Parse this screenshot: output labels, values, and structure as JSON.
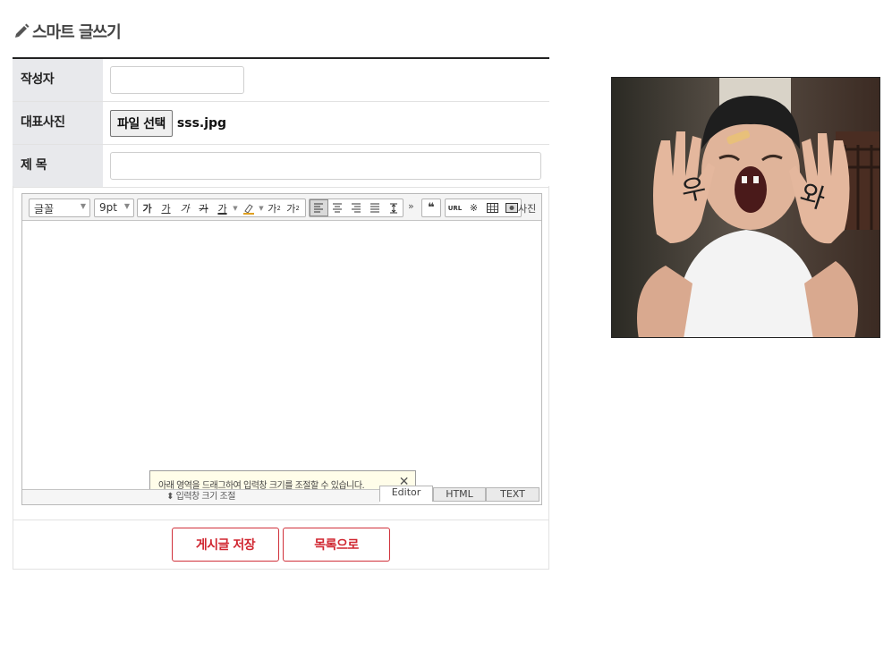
{
  "page": {
    "title": "스마트 글쓰기"
  },
  "form": {
    "author_label": "작성자",
    "author_value": "",
    "photo_label": "대표사진",
    "file_button": "파일 선택",
    "file_name": "sss.jpg",
    "title_label": "제 목",
    "title_value": ""
  },
  "editor": {
    "font_select": "글꼴",
    "size_select": "9pt",
    "format_buttons": [
      "가",
      "가",
      "가",
      "가",
      "가",
      "가",
      "가",
      "가"
    ],
    "more": "»",
    "photo": "사진",
    "tooltip": "아래 영역을 드래그하여 입력창 크기를 조절할 수 있습니다.",
    "resize_label": "⬍ 입력창 크기 조절",
    "tabs": [
      "Editor",
      "HTML",
      "TEXT"
    ],
    "active_tab": "Editor"
  },
  "actions": {
    "save": "게시글 저장",
    "list": "목록으로"
  },
  "colors": {
    "accent": "#d02630",
    "label_bg": "#e8e9ec",
    "tooltip_bg": "#fffde9"
  },
  "icons": [
    "pencil-icon",
    "close-icon",
    "quote-icon",
    "url-icon",
    "special-char-icon",
    "table-icon",
    "photo-icon"
  ]
}
